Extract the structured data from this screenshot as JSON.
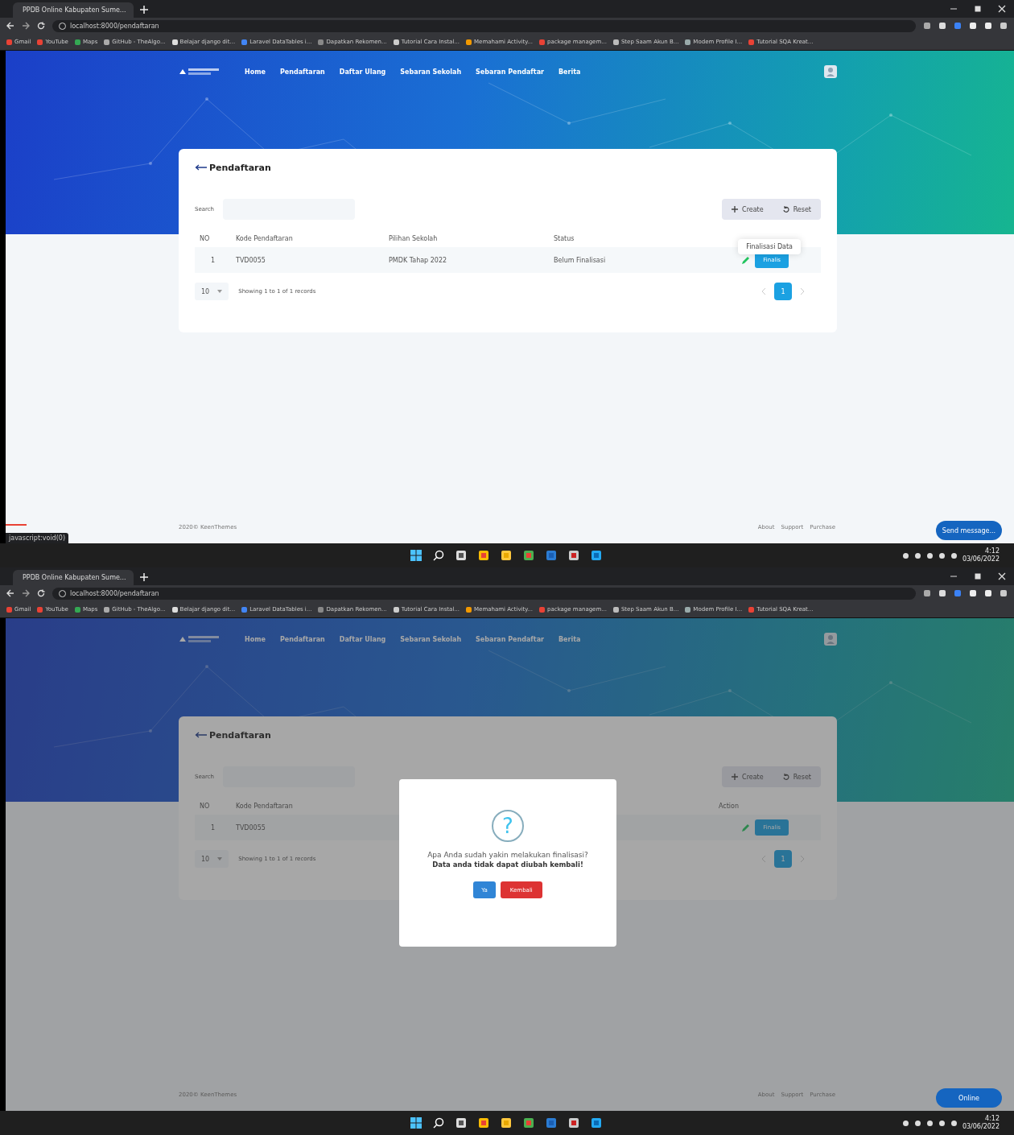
{
  "screens": [
    {
      "browser": {
        "tab_title": "PPDB Online Kabupaten Sume...",
        "address": "localhost:8000/pendaftaran",
        "bookmarks": [
          "Gmail",
          "YouTube",
          "Maps",
          "GitHub - TheAlgo...",
          "Belajar django dit...",
          "Laravel DataTables i...",
          "Dapatkan Rekomen...",
          "Tutorial Cara Instal...",
          "Memahami Activity...",
          "package managem...",
          "Step Saam Akun B...",
          "Modem Profile I...",
          "Tutorial SQA Kreat..."
        ]
      },
      "nav": {
        "items": [
          "Home",
          "Pendaftaran",
          "Daftar Ulang",
          "Sebaran Sekolah",
          "Sebaran Pendaftar",
          "Berita"
        ]
      },
      "card": {
        "title": "Pendaftaran",
        "search_label": "Search",
        "actions": [
          "Create",
          "Reset"
        ],
        "columns": [
          {
            "label": "NO"
          },
          {
            "label": "Kode Pendaftaran"
          },
          {
            "label": "Pilihan Sekolah"
          },
          {
            "label": "Status"
          },
          {}
        ],
        "rows": [
          {
            "cells": [
              "1",
              "TVD0055",
              "PMDK Tahap 2022",
              "Belum Finalisasi"
            ],
            "action": "Finalis"
          }
        ],
        "page_size": "10",
        "info": "Showing 1 to 1 of 1 records",
        "pages": [
          {
            "label": "1",
            "selected": true
          }
        ]
      },
      "tooltip": "Finalisasi Data",
      "footer": {
        "copyright": "2020© KeenThemes",
        "links": [
          "About",
          "Support",
          "Purchase"
        ]
      },
      "chat_button": "Send message...",
      "status_url": "javascript:void(0)",
      "taskbar": {
        "time": "4:12",
        "date": "03/06/2022"
      }
    },
    {
      "browser": {
        "tab_title": "PPDB Online Kabupaten Sume...",
        "address": "localhost:8000/pendaftaran",
        "bookmarks": [
          "Gmail",
          "YouTube",
          "Maps",
          "GitHub - TheAlgo...",
          "Belajar django dit...",
          "Laravel DataTables i...",
          "Dapatkan Rekomen...",
          "Tutorial Cara Instal...",
          "Memahami Activity...",
          "package managem...",
          "Step Saam Akun B...",
          "Modem Profile I...",
          "Tutorial SQA Kreat..."
        ]
      },
      "nav": {
        "items": [
          "Home",
          "Pendaftaran",
          "Daftar Ulang",
          "Sebaran Sekolah",
          "Sebaran Pendaftar",
          "Berita"
        ]
      },
      "card": {
        "title": "Pendaftaran",
        "search_label": "Search",
        "actions": [
          "Create",
          "Reset"
        ],
        "columns": [
          {
            "label": "NO"
          },
          {
            "label": "Kode Pendaftaran"
          },
          {},
          {},
          {
            "label": "Action"
          }
        ],
        "rows": [
          {
            "cells": [
              "1",
              "TVD0055",
              null,
              null
            ],
            "action": "Finalis"
          }
        ],
        "page_size": "10",
        "info": "Showing 1 to 1 of 1 records",
        "pages": [
          {
            "label": "1",
            "selected": true
          }
        ]
      },
      "footer": {
        "copyright": "2020© KeenThemes",
        "links": [
          "About",
          "Support",
          "Purchase"
        ]
      },
      "chat_button": "Online",
      "modal": {
        "icon": "?",
        "message": "Apa Anda sudah yakin melakukan finalisasi?",
        "note": "Data anda tidak dapat diubah kembali!",
        "buttons": [
          {
            "label": "Ya",
            "kind": "confirm"
          },
          {
            "label": "Kembali",
            "kind": "cancel"
          }
        ]
      },
      "taskbar": {
        "time": "4:12",
        "date": "03/06/2022"
      }
    }
  ]
}
